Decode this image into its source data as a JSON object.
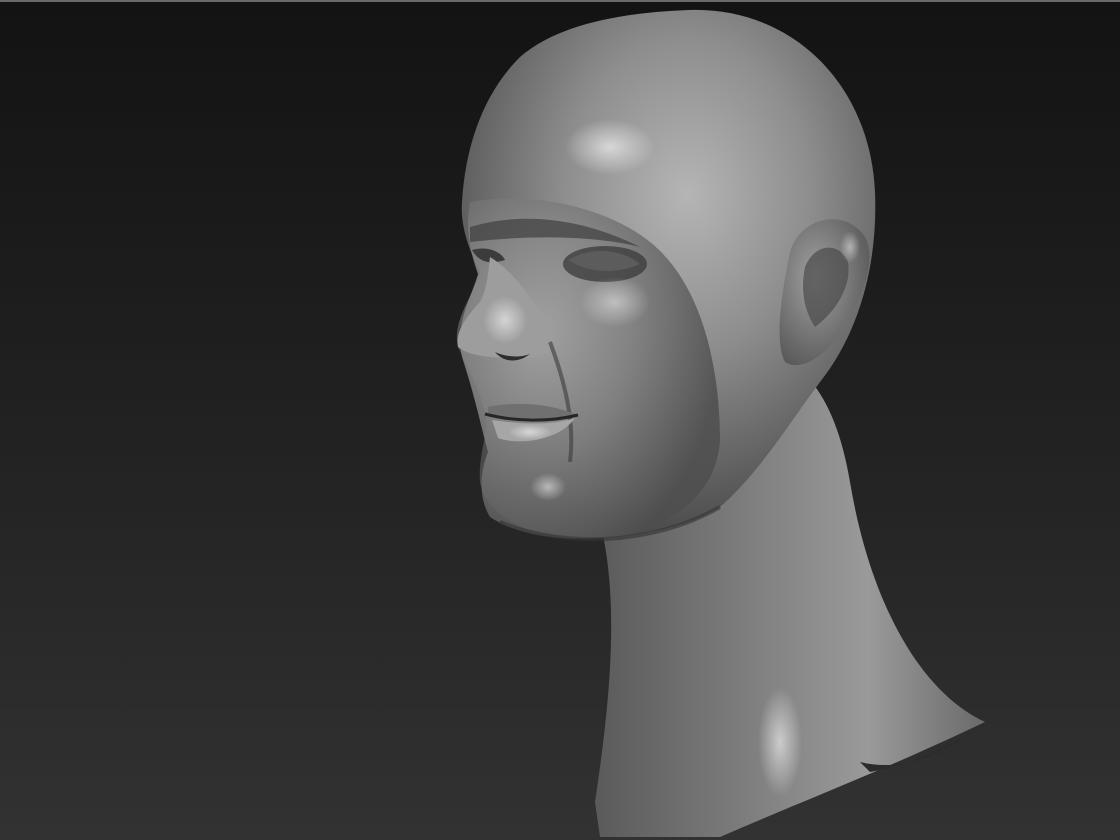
{
  "viewport": {
    "subject": "sculpted-head-bust",
    "material": "matcap-gray",
    "colors": {
      "background_top": "#131313",
      "background_bottom": "#323232",
      "material_base": "#8a8a8a",
      "material_highlight": "#e6e6e6",
      "material_shadow": "#2a2a2a"
    }
  }
}
